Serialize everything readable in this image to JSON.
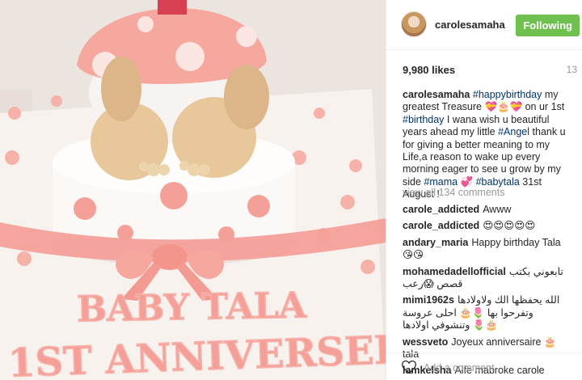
{
  "post": {
    "photo_alt_text": "",
    "cake_text_line1": "BABY TALA",
    "cake_text_line2": "1ST ANNIVERSER"
  },
  "header": {
    "username": "carolesamaha",
    "follow_label": "Following"
  },
  "stats": {
    "likes": "9,980 likes",
    "time": "13"
  },
  "caption": {
    "username": "carolesamaha",
    "parts": {
      "tag_happybirthday": "#happybirthday",
      "text1": " my greatest Treasure 💝🎂💝 on ur 1st ",
      "tag_birthday": "#birthday",
      "text2": " I wana wish u beautiful years ahead my little ",
      "tag_angel": "#Angel",
      "text3": " thank u for giving a better meaning to my Life,a reason to wake up every morning eager to see u grow by my side ",
      "tag_mama": "#mama",
      "text4": " 💞 ",
      "tag_babytala": "#babytala",
      "text5": " 31st August !"
    }
  },
  "view_all": "view all 134 comments",
  "comments": [
    {
      "user": "carole_addicted",
      "text": "Awww",
      "rtl": false
    },
    {
      "user": "carole_addicted",
      "text": "😍😍😍😍😍",
      "rtl": false
    },
    {
      "user": "andary_maria",
      "text": "Happy birthday Tala😘😘",
      "rtl": false
    },
    {
      "user": "mohamedadellofficial",
      "text": "تابعوني بكتب قصص 😱رعب",
      "rtl": false
    },
    {
      "user": "mimi1962s",
      "text": "الله يحفظها الك ولاولادها وتفرحوا بها 🌷🎂 احلى عروسة وتنشوفي اولادها 🌷🎂",
      "rtl": false
    },
    {
      "user": "wessveto",
      "text": "Joyeux anniversaire 🎂 tala",
      "rtl": false
    },
    {
      "user": "lamkelsha",
      "text": "Alfe mabroke carole",
      "rtl": false
    }
  ],
  "add_comment": {
    "placeholder": "Add a comment…"
  },
  "colors": {
    "follow_green": "#70c050",
    "hashtag_blue": "#003569",
    "cake_pink": "#f4a099"
  }
}
